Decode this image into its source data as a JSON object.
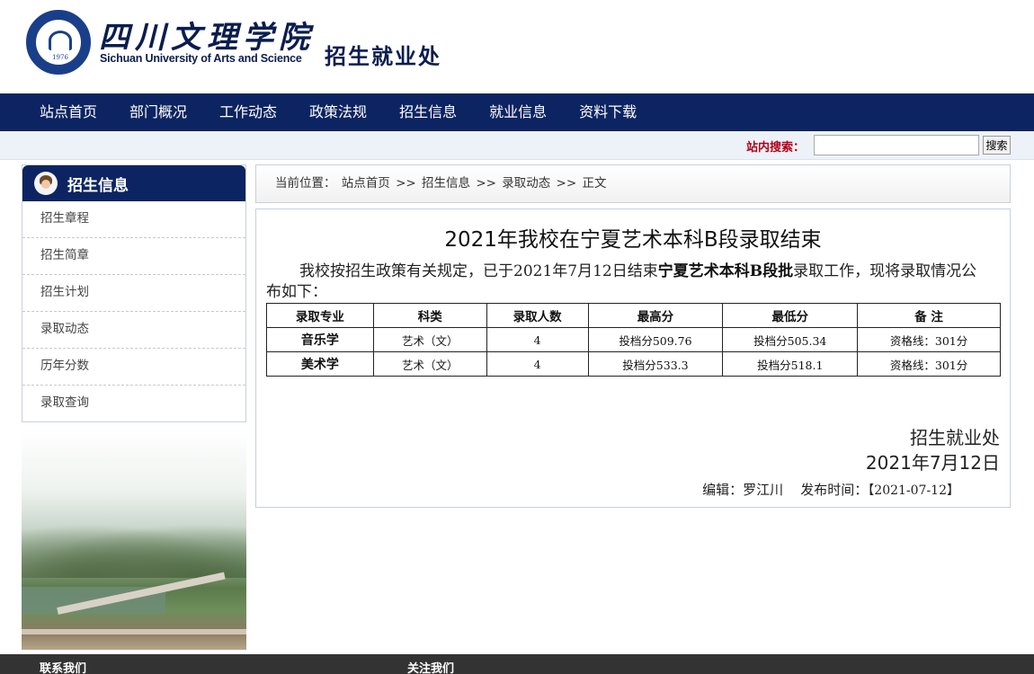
{
  "header": {
    "school_name_cn": "四川文理学院",
    "school_name_en": "Sichuan University of Arts and Science",
    "department": "招生就业处",
    "seal_year": "1976"
  },
  "nav": {
    "items": [
      "站点首页",
      "部门概况",
      "工作动态",
      "政策法规",
      "招生信息",
      "就业信息",
      "资料下载"
    ]
  },
  "search": {
    "label": "站内搜索：",
    "value": "",
    "button": "搜索"
  },
  "sidebar": {
    "title": "招生信息",
    "items": [
      "招生章程",
      "招生简章",
      "招生计划",
      "录取动态",
      "历年分数",
      "录取查询"
    ]
  },
  "breadcrumb": {
    "prefix": "当前位置：",
    "crumbs": [
      "站点首页",
      "招生信息",
      "录取动态",
      "正文"
    ],
    "separator": ">>"
  },
  "article": {
    "title": "2021年我校在宁夏艺术本科B段录取结束",
    "body_pre": "我校按招生政策有关规定，已于2021年7月12日结束",
    "body_bold": "宁夏艺术本科B段批",
    "body_post": "录取工作，现将录取情况公布如下：",
    "table": {
      "headers": [
        "录取专业",
        "科类",
        "录取人数",
        "最高分",
        "最低分",
        "备 注"
      ],
      "rows": [
        [
          "音乐学",
          "艺术（文）",
          "4",
          "投档分509.76",
          "投档分505.34",
          "资格线：301分"
        ],
        [
          "美术学",
          "艺术（文）",
          "4",
          "投档分533.3",
          "投档分518.1",
          "资格线：301分"
        ]
      ]
    },
    "sign_dept": "招生就业处",
    "sign_date": "2021年7月12日",
    "editor_label": "编辑：",
    "editor": "罗江川",
    "publish_label": "发布时间：",
    "publish_time": "【2021-07-12】"
  },
  "footer": {
    "contact": "联系我们",
    "follow": "关注我们"
  }
}
